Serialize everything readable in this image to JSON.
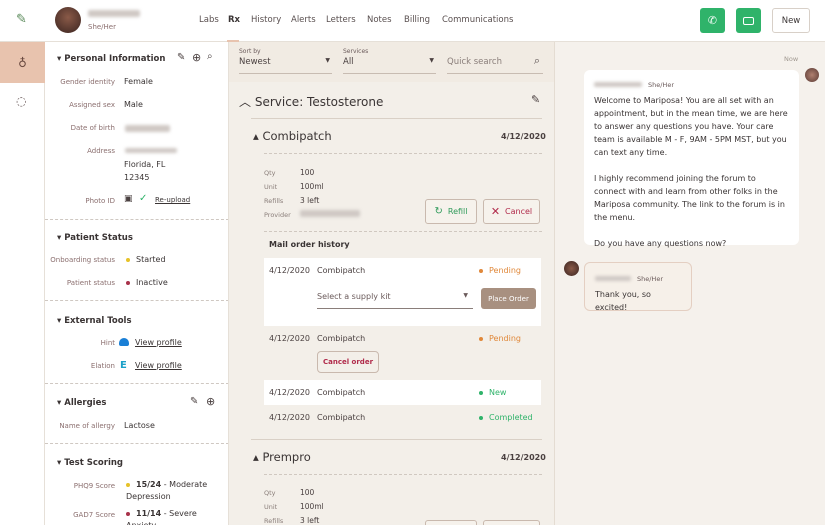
{
  "header": {
    "pronouns": "She/Her",
    "tabs": [
      "Labs",
      "Rx",
      "History",
      "Alerts",
      "Letters",
      "Notes",
      "Billing",
      "Communications"
    ],
    "active_tab": "Rx",
    "new_label": "New",
    "phone_icon": "phone-icon",
    "video_icon": "video-icon"
  },
  "sidebar": {
    "personal": {
      "title": "Personal Information",
      "gender_label": "Gender identity",
      "gender": "Female",
      "sex_label": "Assigned sex",
      "sex": "Male",
      "dob_label": "Date of birth",
      "address_label": "Address",
      "address_city": "Florida, FL",
      "address_zip": "12345",
      "photo_label": "Photo ID",
      "reupload": "Re-upload"
    },
    "status": {
      "title": "Patient Status",
      "onboarding_label": "Onboarding status",
      "onboarding": "Started",
      "patient_label": "Patient status",
      "patient": "Inactive"
    },
    "tools": {
      "title": "External Tools",
      "hint_label": "Hint",
      "elation_label": "Elation",
      "view_profile": "View profile"
    },
    "allergies": {
      "title": "Allergies",
      "name_label": "Name of allergy",
      "name": "Lactose"
    },
    "scoring": {
      "title": "Test Scoring",
      "phq9_label": "PHQ9 Score",
      "phq9_score": "15/24",
      "phq9_desc": "- Moderate Depression",
      "gad7_label": "GAD7 Score",
      "gad7_score": "11/14",
      "gad7_desc": "- Severe Anxiety"
    }
  },
  "filters": {
    "sort_label": "Sort by",
    "sort_value": "Newest",
    "services_label": "Services",
    "services_value": "All",
    "search_placeholder": "Quick search"
  },
  "service": {
    "title": "Service: Testosterone",
    "rx1": {
      "name": "Combipatch",
      "date": "4/12/2020",
      "qty_label": "Qty",
      "qty": "100",
      "unit_label": "Unit",
      "unit": "100ml",
      "refills_label": "Refills",
      "refills": "3 left",
      "provider_label": "Provider",
      "refill_btn": "Refill",
      "cancel_btn": "Cancel",
      "history_title": "Mail order history",
      "supply_placeholder": "Select a supply kit",
      "place_order": "Place Order",
      "cancel_order": "Cancel order",
      "orders": [
        {
          "date": "4/12/2020",
          "name": "Combipatch",
          "status": "Pending"
        },
        {
          "date": "4/12/2020",
          "name": "Combipatch",
          "status": "Pending"
        },
        {
          "date": "4/12/2020",
          "name": "Combipatch",
          "status": "New"
        },
        {
          "date": "4/12/2020",
          "name": "Combipatch",
          "status": "Completed"
        }
      ]
    },
    "rx2": {
      "name": "Prempro",
      "date": "4/12/2020",
      "qty_label": "Qty",
      "qty": "100",
      "unit_label": "Unit",
      "unit": "100ml",
      "refills_label": "Refills",
      "refills": "3 left"
    }
  },
  "chat": {
    "time": "Now",
    "msg1_pronouns": "She/Her",
    "msg1_p1": "Welcome to Mariposa! You are all set with an appointment, but in the mean time, we are here to answer any questions you have. Your care team is available M - F, 9AM - 5PM MST, but you can text any time.",
    "msg1_p2": "I highly recommend joining the forum to connect with and learn from other folks in the Mariposa community. The link to the forum is in the menu.",
    "msg1_p3": "Do you have any questions now?",
    "msg2_pronouns": "She/Her",
    "msg2": "Thank you, so excited!"
  },
  "colors": {
    "green": "#2fb36a",
    "pending": "#e0883a",
    "inactive": "#a8324a",
    "started": "#e6c229",
    "accent": "#e8c3ae"
  }
}
